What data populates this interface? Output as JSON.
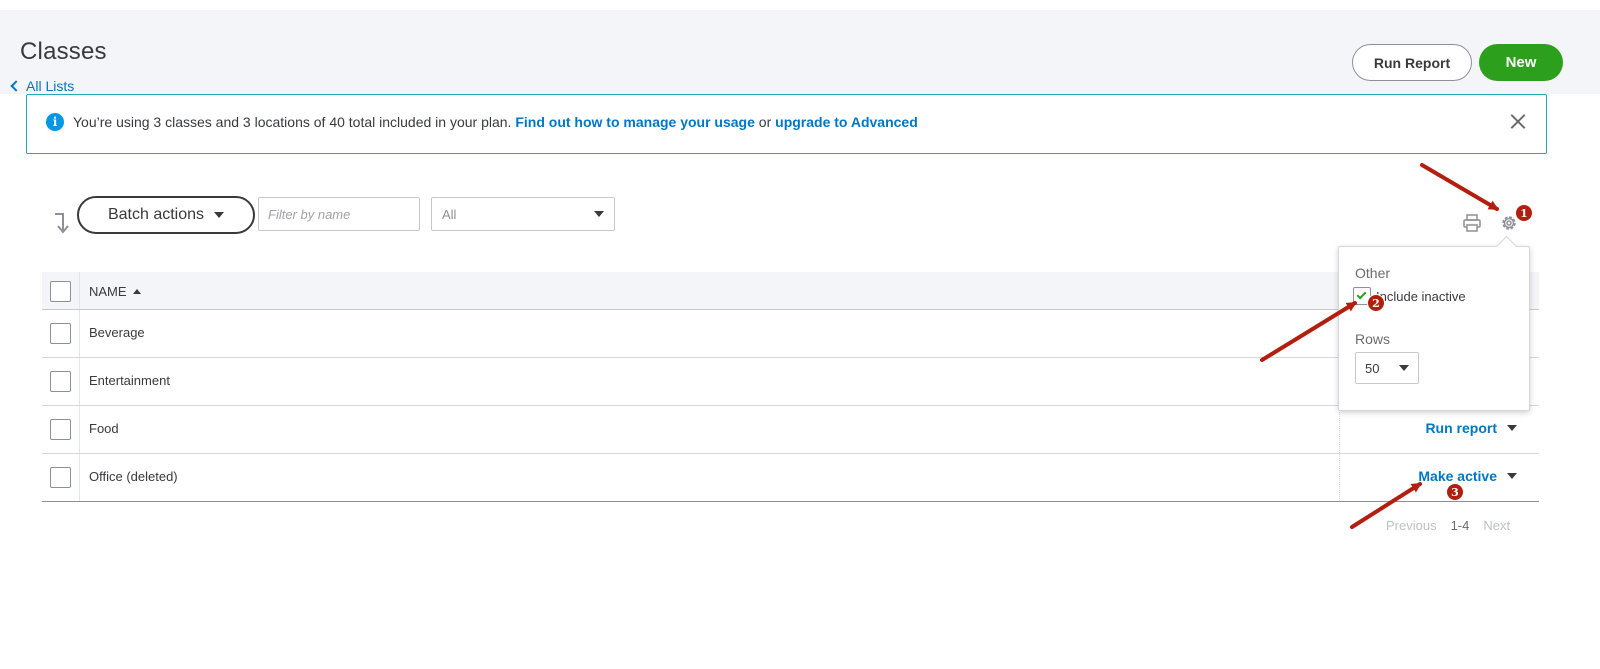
{
  "header": {
    "title": "Classes",
    "back_link": "All Lists",
    "run_report_label": "Run Report",
    "new_label": "New"
  },
  "banner": {
    "text_before": "You’re using 3 classes and 3 locations of 40 total included in your plan.",
    "link1": "Find out how to manage your usage",
    "connector": "or",
    "link2": "upgrade to Advanced"
  },
  "toolbar": {
    "batch_actions_label": "Batch actions",
    "filter_placeholder": "Filter by name",
    "status_filter_value": "All"
  },
  "table": {
    "column_name": "NAME",
    "rows": [
      {
        "name": "Beverage",
        "action": ""
      },
      {
        "name": "Entertainment",
        "action": ""
      },
      {
        "name": "Food",
        "action": "Run report"
      },
      {
        "name": "Office (deleted)",
        "action": "Make active"
      }
    ]
  },
  "pagination": {
    "previous": "Previous",
    "range": "1-4",
    "next": "Next"
  },
  "settings_popover": {
    "other_heading": "Other",
    "include_inactive_label": "Include inactive",
    "include_inactive_checked": true,
    "rows_heading": "Rows",
    "rows_value": "50"
  },
  "annotations": {
    "badge1": "1",
    "badge2": "2",
    "badge3": "3",
    "color": "#b21f0f"
  },
  "colors": {
    "accent_link": "#0077c5",
    "new_button": "#2ca01c",
    "banner_border": "#21abb8"
  }
}
